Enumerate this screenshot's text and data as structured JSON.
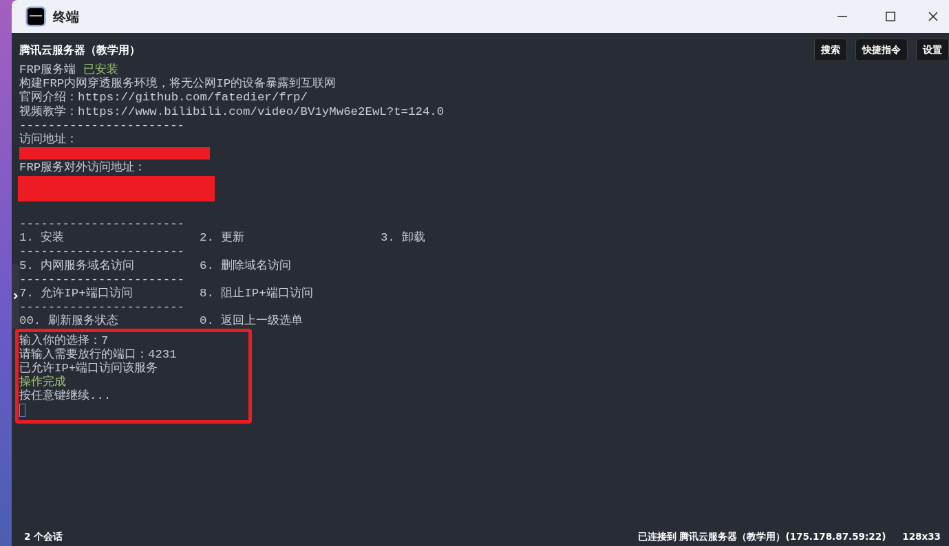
{
  "window": {
    "title": "终端"
  },
  "session": {
    "title": "腾讯云服务器（教学用）",
    "buttons": [
      "搜索",
      "快捷指令",
      "设置"
    ]
  },
  "terminal": {
    "lines": [
      {
        "kind": "text",
        "segments": [
          {
            "text": "FRP服务端 ",
            "color": "#c8ccd4"
          },
          {
            "text": "已安装",
            "color": "#98c379"
          }
        ]
      },
      {
        "kind": "text",
        "segments": [
          {
            "text": "构建FRP内网穿透服务环境，将无公网IP的设备暴露到互联网",
            "color": "#c8ccd4"
          }
        ]
      },
      {
        "kind": "text",
        "segments": [
          {
            "text": "官网介绍：https://github.com/fatedier/frp/",
            "color": "#c8ccd4"
          }
        ]
      },
      {
        "kind": "text",
        "segments": [
          {
            "text": "视频教学：https://www.bilibili.com/video/BV1yMw6e2EwL?t=124.0",
            "color": "#c8ccd4"
          }
        ]
      },
      {
        "kind": "separator",
        "text": "-----------------------"
      },
      {
        "kind": "text",
        "segments": [
          {
            "text": "访问地址：",
            "color": "#c8ccd4"
          }
        ]
      },
      {
        "kind": "redaction"
      },
      {
        "kind": "text",
        "segments": [
          {
            "text": "FRP服务对外访问地址：",
            "color": "#c8ccd4"
          }
        ]
      },
      {
        "kind": "redaction_tall"
      },
      {
        "kind": "blank"
      },
      {
        "kind": "separator",
        "text": "-----------------------"
      },
      {
        "kind": "menu",
        "cells": [
          "1. 安装",
          "2. 更新",
          "3. 卸载"
        ]
      },
      {
        "kind": "separator",
        "text": "-----------------------"
      },
      {
        "kind": "menu",
        "cells": [
          "5. 内网服务域名访问",
          "6. 删除域名访问"
        ]
      },
      {
        "kind": "separator",
        "text": "-----------------------"
      },
      {
        "kind": "menu",
        "cells": [
          "7. 允许IP+端口访问",
          "8. 阻止IP+端口访问"
        ]
      },
      {
        "kind": "separator",
        "text": "-----------------------"
      },
      {
        "kind": "menu",
        "cells": [
          "00. 刷新服务状态",
          "0. 返回上一级选单"
        ]
      }
    ],
    "highlighted_lines": [
      {
        "kind": "text",
        "segments": [
          {
            "text": "输入你的选择：7",
            "color": "#c8ccd4"
          }
        ]
      },
      {
        "kind": "text",
        "segments": [
          {
            "text": "请输入需要放行的端口：4231",
            "color": "#c8ccd4"
          }
        ]
      },
      {
        "kind": "text",
        "segments": [
          {
            "text": "已允许IP+端口访问该服务",
            "color": "#c8ccd4"
          }
        ]
      },
      {
        "kind": "text",
        "segments": [
          {
            "text": "操作完成",
            "color": "#98c379"
          }
        ]
      },
      {
        "kind": "text",
        "segments": [
          {
            "text": "按任意键继续...",
            "color": "#c8ccd4"
          }
        ]
      },
      {
        "kind": "cursor"
      }
    ]
  },
  "status_bar": {
    "sessions": "2 个会话",
    "connection": "已连接到 腾讯云服务器（教学用）(175.178.87.59:22)",
    "size": "128x33"
  }
}
